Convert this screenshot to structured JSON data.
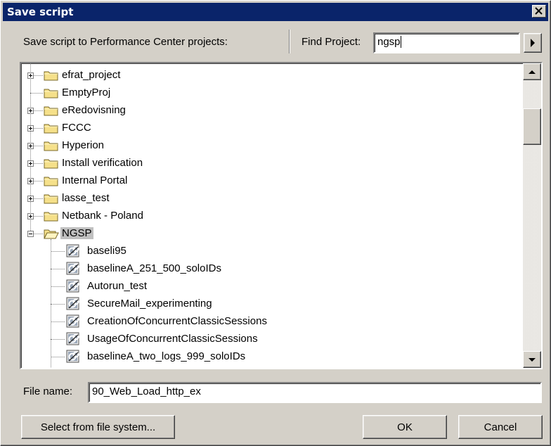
{
  "window": {
    "title": "Save script"
  },
  "header": {
    "save_label": "Save script to Performance Center projects:",
    "find_label": "Find Project:",
    "find_value": "ngsp"
  },
  "tree": {
    "folders": [
      {
        "label": "efrat_project",
        "expander": "plus"
      },
      {
        "label": "EmptyProj",
        "expander": "none"
      },
      {
        "label": "eRedovisning",
        "expander": "plus"
      },
      {
        "label": "FCCC",
        "expander": "plus"
      },
      {
        "label": "Hyperion",
        "expander": "plus"
      },
      {
        "label": "Install verification",
        "expander": "plus"
      },
      {
        "label": "Internal Portal",
        "expander": "plus"
      },
      {
        "label": "lasse_test",
        "expander": "plus"
      },
      {
        "label": "Netbank - Poland",
        "expander": "plus"
      },
      {
        "label": "NGSP",
        "expander": "minus",
        "selected": true
      }
    ],
    "scripts": [
      "baseli95",
      "baselineA_251_500_soloIDs",
      "Autorun_test",
      "SecureMail_experimenting",
      "CreationOfConcurrentClassicSessions",
      "UsageOfConcurrentClassicSessions",
      "baselineA_two_logs_999_soloIDs"
    ]
  },
  "filename": {
    "label": "File name:",
    "value": "90_Web_Load_http_ex"
  },
  "buttons": {
    "select_fs": "Select from file system...",
    "ok": "OK",
    "cancel": "Cancel"
  },
  "colors": {
    "titlebar": "#0a246a",
    "face": "#d4d0c8",
    "folder": "#f5e08a",
    "selection": "#c0c0c0"
  },
  "icons": [
    "close-icon",
    "arrow-right-icon",
    "folder-icon",
    "folder-open-icon",
    "script-icon",
    "scroll-up-icon",
    "scroll-down-icon"
  ]
}
